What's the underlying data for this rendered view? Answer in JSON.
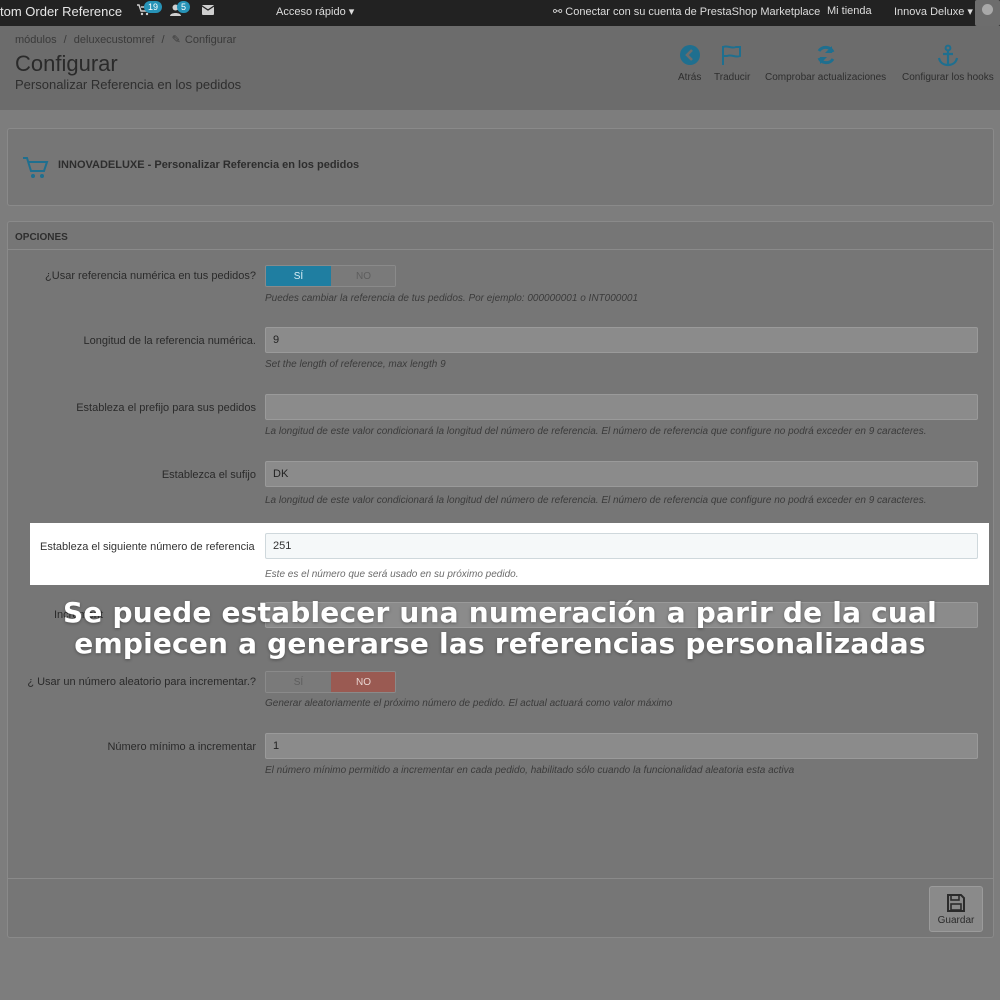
{
  "topbar": {
    "app_title": "tom Order Reference",
    "cart_badge": "19",
    "users_badge": "5",
    "quick_access": "Acceso rápido ▾",
    "marketplace": "Conectar con su cuenta de PrestaShop Marketplace",
    "my_store": "Mi tienda",
    "user_name": "Innova Deluxe ▾"
  },
  "header": {
    "breadcrumb": [
      "módulos",
      "/",
      "deluxecustomref",
      "/",
      "Configurar"
    ],
    "title": "Configurar",
    "subtitle": "Personalizar Referencia en los pedidos",
    "toolbar": [
      {
        "label": "Atrás",
        "icon": "back-arrow-icon"
      },
      {
        "label": "Traducir",
        "icon": "flag-icon"
      },
      {
        "label": "Comprobar actualizaciones",
        "icon": "refresh-icon"
      },
      {
        "label": "Configurar los hooks",
        "icon": "anchor-icon"
      }
    ]
  },
  "module": {
    "title": "INNOVADELUXE  -  Personalizar Referencia en los pedidos",
    "icon": "shopping-cart-icon"
  },
  "options": {
    "header": "OPCIONES",
    "use_numeric": {
      "label": "¿Usar referencia numérica en tus pedidos?",
      "yes": "SÍ",
      "no": "NO",
      "selected": "SÍ",
      "help": "Puedes cambiar la referencia de tus pedidos. Por ejemplo: 000000001 o INT000001"
    },
    "length": {
      "label": "Longitud de la referencia numérica.",
      "value": "9",
      "help": "Set the length of reference, max length 9"
    },
    "prefix": {
      "label": "Estableza el prefijo para sus pedidos",
      "value": "",
      "help": "La longitud de este valor condicionará la longitud del número de referencia. El número de referencia que configure no podrá exceder en 9 caracteres."
    },
    "suffix": {
      "label": "Establezca el sufijo",
      "value": "DK",
      "help": "La longitud de este valor condicionará la longitud del número de referencia. El número de referencia que configure no podrá exceder en 9 caracteres."
    },
    "next_number": {
      "label": "Estableza el siguiente número de referencia",
      "value": "251",
      "help": "Este es el número que será usado en su próximo pedido."
    },
    "increment": {
      "label": "Increment",
      "value": ""
    },
    "random": {
      "label": "¿ Usar un número aleatorio para incrementar.?",
      "yes": "SÍ",
      "no": "NO",
      "selected": "NO",
      "help": "Generar aleatoriamente el próximo número de pedido. El actual actuará como valor máximo"
    },
    "min_increment": {
      "label": "Número mínimo a incrementar",
      "value": "1",
      "help": "El número mínimo permitido a incrementar en cada pedido, habilitado sólo cuando la funcionalidad aleatoria esta activa"
    },
    "save": "Guardar"
  },
  "caption": {
    "line1": "Se puede establecer una numeración a parir de la cual",
    "line2": "empiecen a generarse las referencias personalizadas"
  }
}
